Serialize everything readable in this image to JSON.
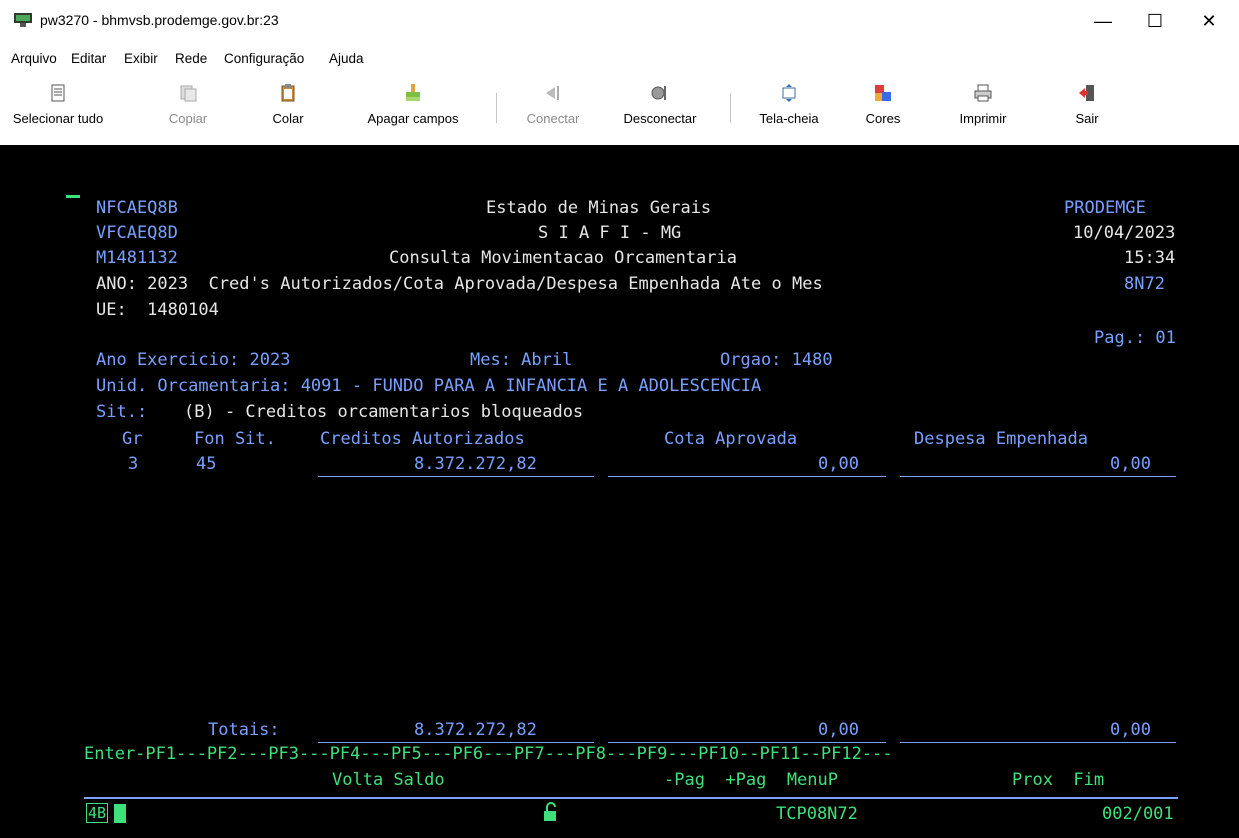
{
  "window": {
    "title": "pw3270 - bhmvsb.prodemge.gov.br:23",
    "controls": {
      "minimize": "—",
      "maximize": "☐",
      "close": "✕"
    }
  },
  "menu": [
    "Arquivo",
    "Editar",
    "Exibir",
    "Rede",
    "Configuração",
    "Ajuda"
  ],
  "toolbar": {
    "select_all": "Selecionar tudo",
    "copy": "Copiar",
    "paste": "Colar",
    "erase_fields": "Apagar campos",
    "connect": "Conectar",
    "disconnect": "Desconectar",
    "fullscreen": "Tela-cheia",
    "colors": "Cores",
    "print": "Imprimir",
    "exit": "Sair"
  },
  "screen": {
    "program1": "NFCAEQ8B",
    "program2": "VFCAEQ8D",
    "program3": "M1481132",
    "header_title1": "Estado de Minas Gerais",
    "header_title2": "S I A F I - MG",
    "header_title3": "Consulta Movimentacao Orcamentaria",
    "prodemge": "PRODEMGE",
    "date": "10/04/2023",
    "time": "15:34",
    "ano_line": "ANO: 2023  Cred's Autorizados/Cota Aprovada/Despesa Empenhada Ate o Mes",
    "screen_code": "8N72",
    "ue_line": "UE:  1480104",
    "page": "Pag.: 01",
    "ano_exercicio": "Ano Exercicio: 2023",
    "mes": "Mes: Abril",
    "orgao": "Orgao: 1480",
    "unid_label": "Unid. Orcamentaria: 4091 - FUNDO PARA A INFANCIA E A ADOLESCENCIA",
    "sit_label": "Sit.:",
    "sit_value": "(B) - Creditos orcamentarios bloqueados",
    "col_headers": {
      "gr": "Gr",
      "fon_sit": "Fon Sit.",
      "creditos": "Creditos Autorizados",
      "cota": "Cota Aprovada",
      "despesa": "Despesa Empenhada"
    },
    "rows": [
      {
        "gr": "3",
        "fon": "45",
        "creditos": "8.372.272,82",
        "cota": "0,00",
        "despesa": "0,00"
      }
    ],
    "totais_label": "Totais:",
    "totais": {
      "creditos": "8.372.272,82",
      "cota": "0,00",
      "despesa": "0,00"
    },
    "pf_line": "Enter-PF1---PF2---PF3---PF4---PF5---PF6---PF7---PF8---PF9---PF10--PF11--PF12---",
    "pf_labels_1": "Volta Saldo",
    "pf_labels_2": "-Pag  +Pag  MenuP",
    "pf_labels_3": "Prox  Fim"
  },
  "status": {
    "indicator": "4B",
    "terminal_id": "TCP08N72",
    "cursor_pos": "002/001"
  }
}
